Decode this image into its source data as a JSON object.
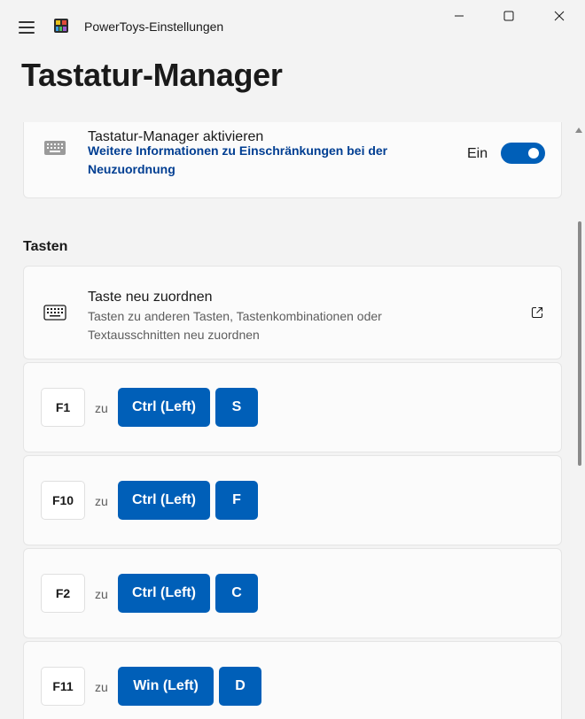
{
  "window": {
    "title": "PowerToys-Einstellungen"
  },
  "page": {
    "title": "Tastatur-Manager"
  },
  "activate_card": {
    "title": "Tastatur-Manager aktivieren",
    "link": "Weitere Informationen zu Einschränkungen bei der Neuzuordnung",
    "toggle_label": "Ein",
    "toggle_on": true
  },
  "keys_section": {
    "heading": "Tasten",
    "remap_card": {
      "title": "Taste neu zuordnen",
      "description": "Tasten zu anderen Tasten, Tastenkombinationen oder Textausschnitten neu zuordnen"
    },
    "connector": "zu",
    "mappings": [
      {
        "from": "F1",
        "to": [
          "Ctrl (Left)",
          "S"
        ]
      },
      {
        "from": "F10",
        "to": [
          "Ctrl (Left)",
          "F"
        ]
      },
      {
        "from": "F2",
        "to": [
          "Ctrl (Left)",
          "C"
        ]
      },
      {
        "from": "F11",
        "to": [
          "Win (Left)",
          "D"
        ]
      }
    ]
  },
  "colors": {
    "accent": "#005fb8",
    "link": "#003e92",
    "background": "#f3f3f3",
    "card": "#fbfbfb"
  },
  "icons": {
    "menu": "hamburger-icon",
    "app": "powertoys-logo-icon",
    "keyboard": "keyboard-icon",
    "external": "open-external-icon",
    "minimize": "minimize-icon",
    "maximize": "maximize-icon",
    "close": "close-icon"
  }
}
